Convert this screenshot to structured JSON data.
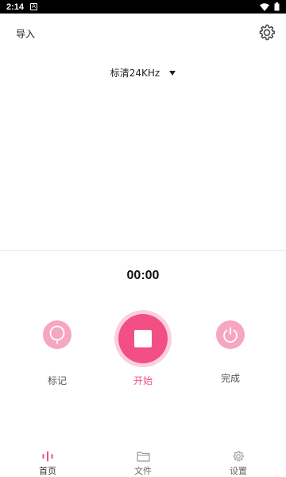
{
  "status_bar": {
    "time": "2:14",
    "notification_glyph": "A"
  },
  "top_bar": {
    "import_label": "导入",
    "settings_icon": "gear-icon"
  },
  "quality": {
    "label": "标清24KHz"
  },
  "recorder": {
    "timer": "00:00"
  },
  "controls": {
    "mark_label": "标记",
    "start_label": "开始",
    "finish_label": "完成"
  },
  "tabs": [
    {
      "label": "首页",
      "icon": "waveform-icon",
      "active": true
    },
    {
      "label": "文件",
      "icon": "folder-icon",
      "active": false
    },
    {
      "label": "设置",
      "icon": "gear-icon",
      "active": false
    }
  ],
  "colors": {
    "accent": "#f24f84",
    "accent_light": "#f7a6c0",
    "accent_ring": "#fbd0de"
  }
}
